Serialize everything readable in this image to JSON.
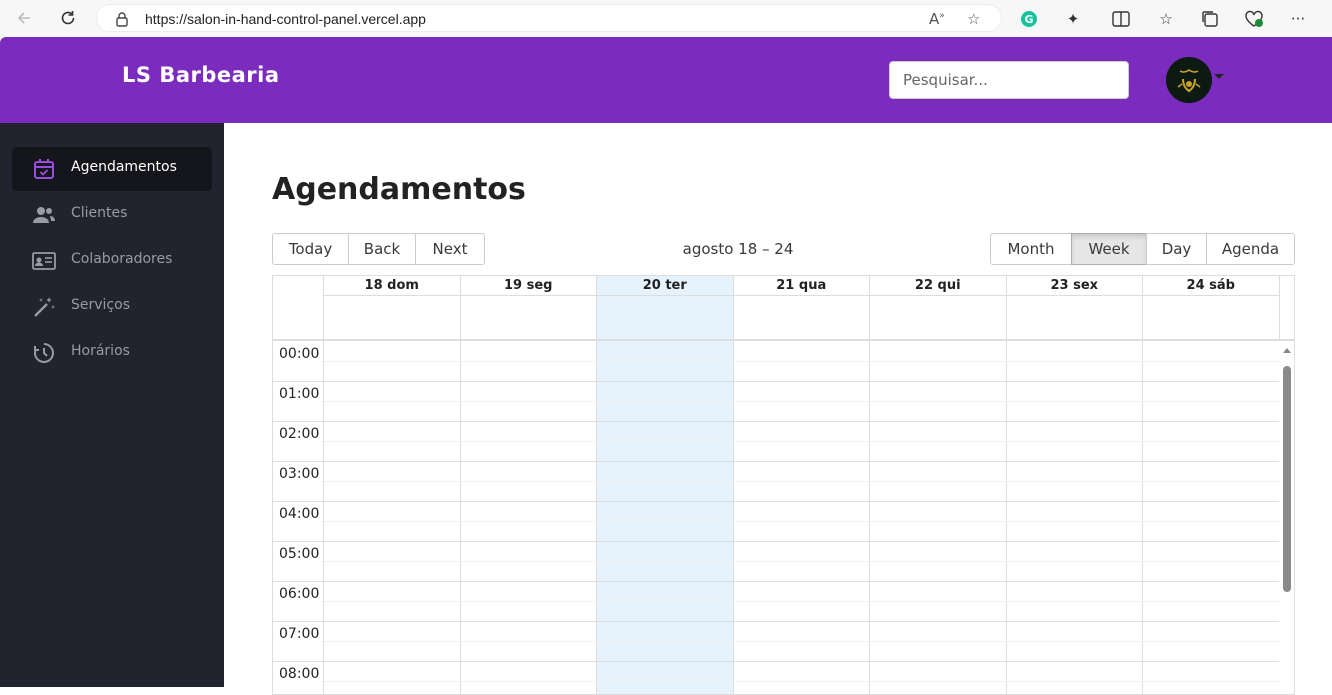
{
  "browser": {
    "url": "https://salon-in-hand-control-panel.vercel.app"
  },
  "header": {
    "brand": "LS Barbearia",
    "search_placeholder": "Pesquisar..."
  },
  "sidebar": {
    "items": [
      {
        "label": "Agendamentos",
        "icon": "calendar-check-icon",
        "active": true
      },
      {
        "label": "Clientes",
        "icon": "users-icon",
        "active": false
      },
      {
        "label": "Colaboradores",
        "icon": "id-card-icon",
        "active": false
      },
      {
        "label": "Serviços",
        "icon": "magic-wand-icon",
        "active": false
      },
      {
        "label": "Horários",
        "icon": "clock-history-icon",
        "active": false
      }
    ]
  },
  "main": {
    "title": "Agendamentos",
    "nav_buttons": [
      "Today",
      "Back",
      "Next"
    ],
    "range_label": "agosto 18 – 24",
    "view_buttons": [
      "Month",
      "Week",
      "Day",
      "Agenda"
    ],
    "active_view": "Week",
    "days": [
      "18 dom",
      "19 seg",
      "20 ter",
      "21 qua",
      "22 qui",
      "23 sex",
      "24 sáb"
    ],
    "today_index": 2,
    "times": [
      "00:00",
      "01:00",
      "02:00",
      "03:00",
      "04:00",
      "05:00",
      "06:00",
      "07:00",
      "08:00"
    ]
  },
  "colors": {
    "brand_purple": "#7b2cbf",
    "sidebar_bg": "#22232e",
    "today_highlight": "#e6f3fd"
  }
}
